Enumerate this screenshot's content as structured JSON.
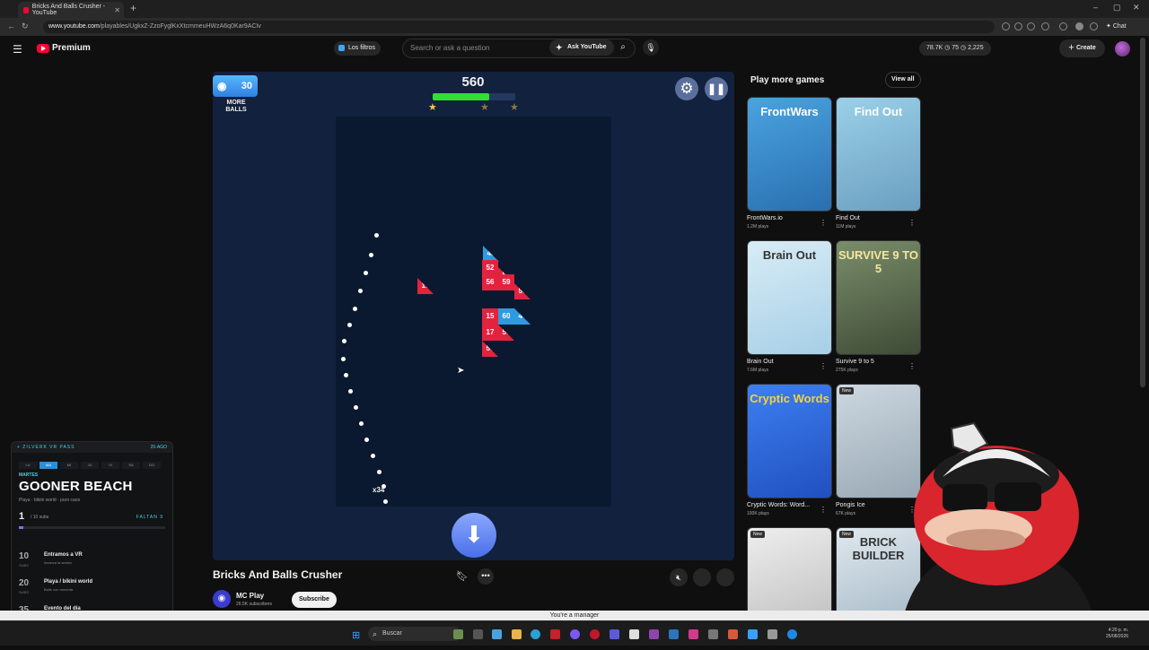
{
  "browser": {
    "tab_title": "Bricks And Balls Crusher - YouTube",
    "url_host": "www.youtube.com",
    "url_path": "/playables/UgkxZ-ZzoFyglKxXtcmmeuHWzA6q0Kar9ACIv",
    "chat_label": "Chat"
  },
  "header": {
    "logo_text": "Premium",
    "filters_label": "Los filtros",
    "search_placeholder": "Search or ask a question",
    "ask_label": "Ask YouTube",
    "stats": "78.7K  ◷ 75  ◷ 2,225",
    "create_label": "Create"
  },
  "game": {
    "more_balls_count": "30",
    "more_balls_label_1": "MORE",
    "more_balls_label_2": "BALLS",
    "score": "560",
    "progress": 0.68,
    "ball_count": "x34",
    "bricks": [
      {
        "v": "48",
        "c": "blue"
      },
      {
        "v": "52",
        "c": "red"
      },
      {
        "v": "50",
        "c": "red"
      },
      {
        "v": "56",
        "c": "red"
      },
      {
        "v": "59",
        "c": "red"
      },
      {
        "v": "50",
        "c": "red"
      },
      {
        "v": "19",
        "c": "red"
      },
      {
        "v": "15",
        "c": "red"
      },
      {
        "v": "60",
        "c": "blue"
      },
      {
        "v": "44",
        "c": "blue"
      },
      {
        "v": "17",
        "c": "red"
      },
      {
        "v": "50",
        "c": "red"
      },
      {
        "v": "50",
        "c": "red"
      }
    ]
  },
  "video": {
    "title": "Bricks And Balls Crusher",
    "channel": "MC Play",
    "subscribers": "26.5K subscribers",
    "subscribe_label": "Subscribe"
  },
  "sidebar": {
    "heading": "Play more games",
    "view_all": "View all",
    "games": [
      {
        "name": "FrontWars.io",
        "plays": "1.2M plays",
        "thumb_text": "FrontWars",
        "new": ""
      },
      {
        "name": "Find Out",
        "plays": "11M plays",
        "thumb_text": "Find Out",
        "new": ""
      },
      {
        "name": "Brain Out",
        "plays": "7.6M plays",
        "thumb_text": "Brain Out",
        "new": ""
      },
      {
        "name": "Survive 9 to 5",
        "plays": "275K plays",
        "thumb_text": "SURVIVE 9 TO 5",
        "new": ""
      },
      {
        "name": "Cryptic Words: Word...",
        "plays": "100K plays",
        "thumb_text": "Cryptic Words",
        "new": ""
      },
      {
        "name": "Pongis Ice",
        "plays": "67K plays",
        "thumb_text": "",
        "new": "New"
      },
      {
        "name": "",
        "plays": "",
        "thumb_text": "",
        "new": "New"
      },
      {
        "name": "",
        "plays": "",
        "thumb_text": "BRICK BUILDER",
        "new": "New"
      }
    ]
  },
  "overlay": {
    "header": "+ ZILVERK VR PASS",
    "date": "25-AGO",
    "days": [
      "LU",
      "MA",
      "MI",
      "JU",
      "VI",
      "SA",
      "DO"
    ],
    "active_day": 1,
    "weekday": "MARTES",
    "title": "GOONER BEACH",
    "subtitle": "Playa · bikini world · puro caos",
    "count": "1",
    "count_of": "/ 10 subs",
    "faltan": "FALTAN 9",
    "progress": 0.03,
    "goals": [
      {
        "num": "10",
        "subs": "SUBS",
        "name": "Entramos a VR",
        "desc": "Arranca la sesión"
      },
      {
        "num": "20",
        "subs": "SUBS",
        "name": "Playa / bikini world",
        "desc": "Baile con moneda"
      },
      {
        "num": "35",
        "subs": "SUBS",
        "name": "Evento del día",
        "desc": "Concurso · ranking · quién se roba el chat"
      }
    ],
    "footer_label": "SIGUIENTE:",
    "footer_value": "ENTRAMOS A VR",
    "footer_right": "LA META"
  },
  "status": {
    "manager_text": "You're a manager"
  },
  "taskbar": {
    "search_label": "Buscar",
    "time": "4:20 p. m.",
    "date": "25/08/2026"
  }
}
